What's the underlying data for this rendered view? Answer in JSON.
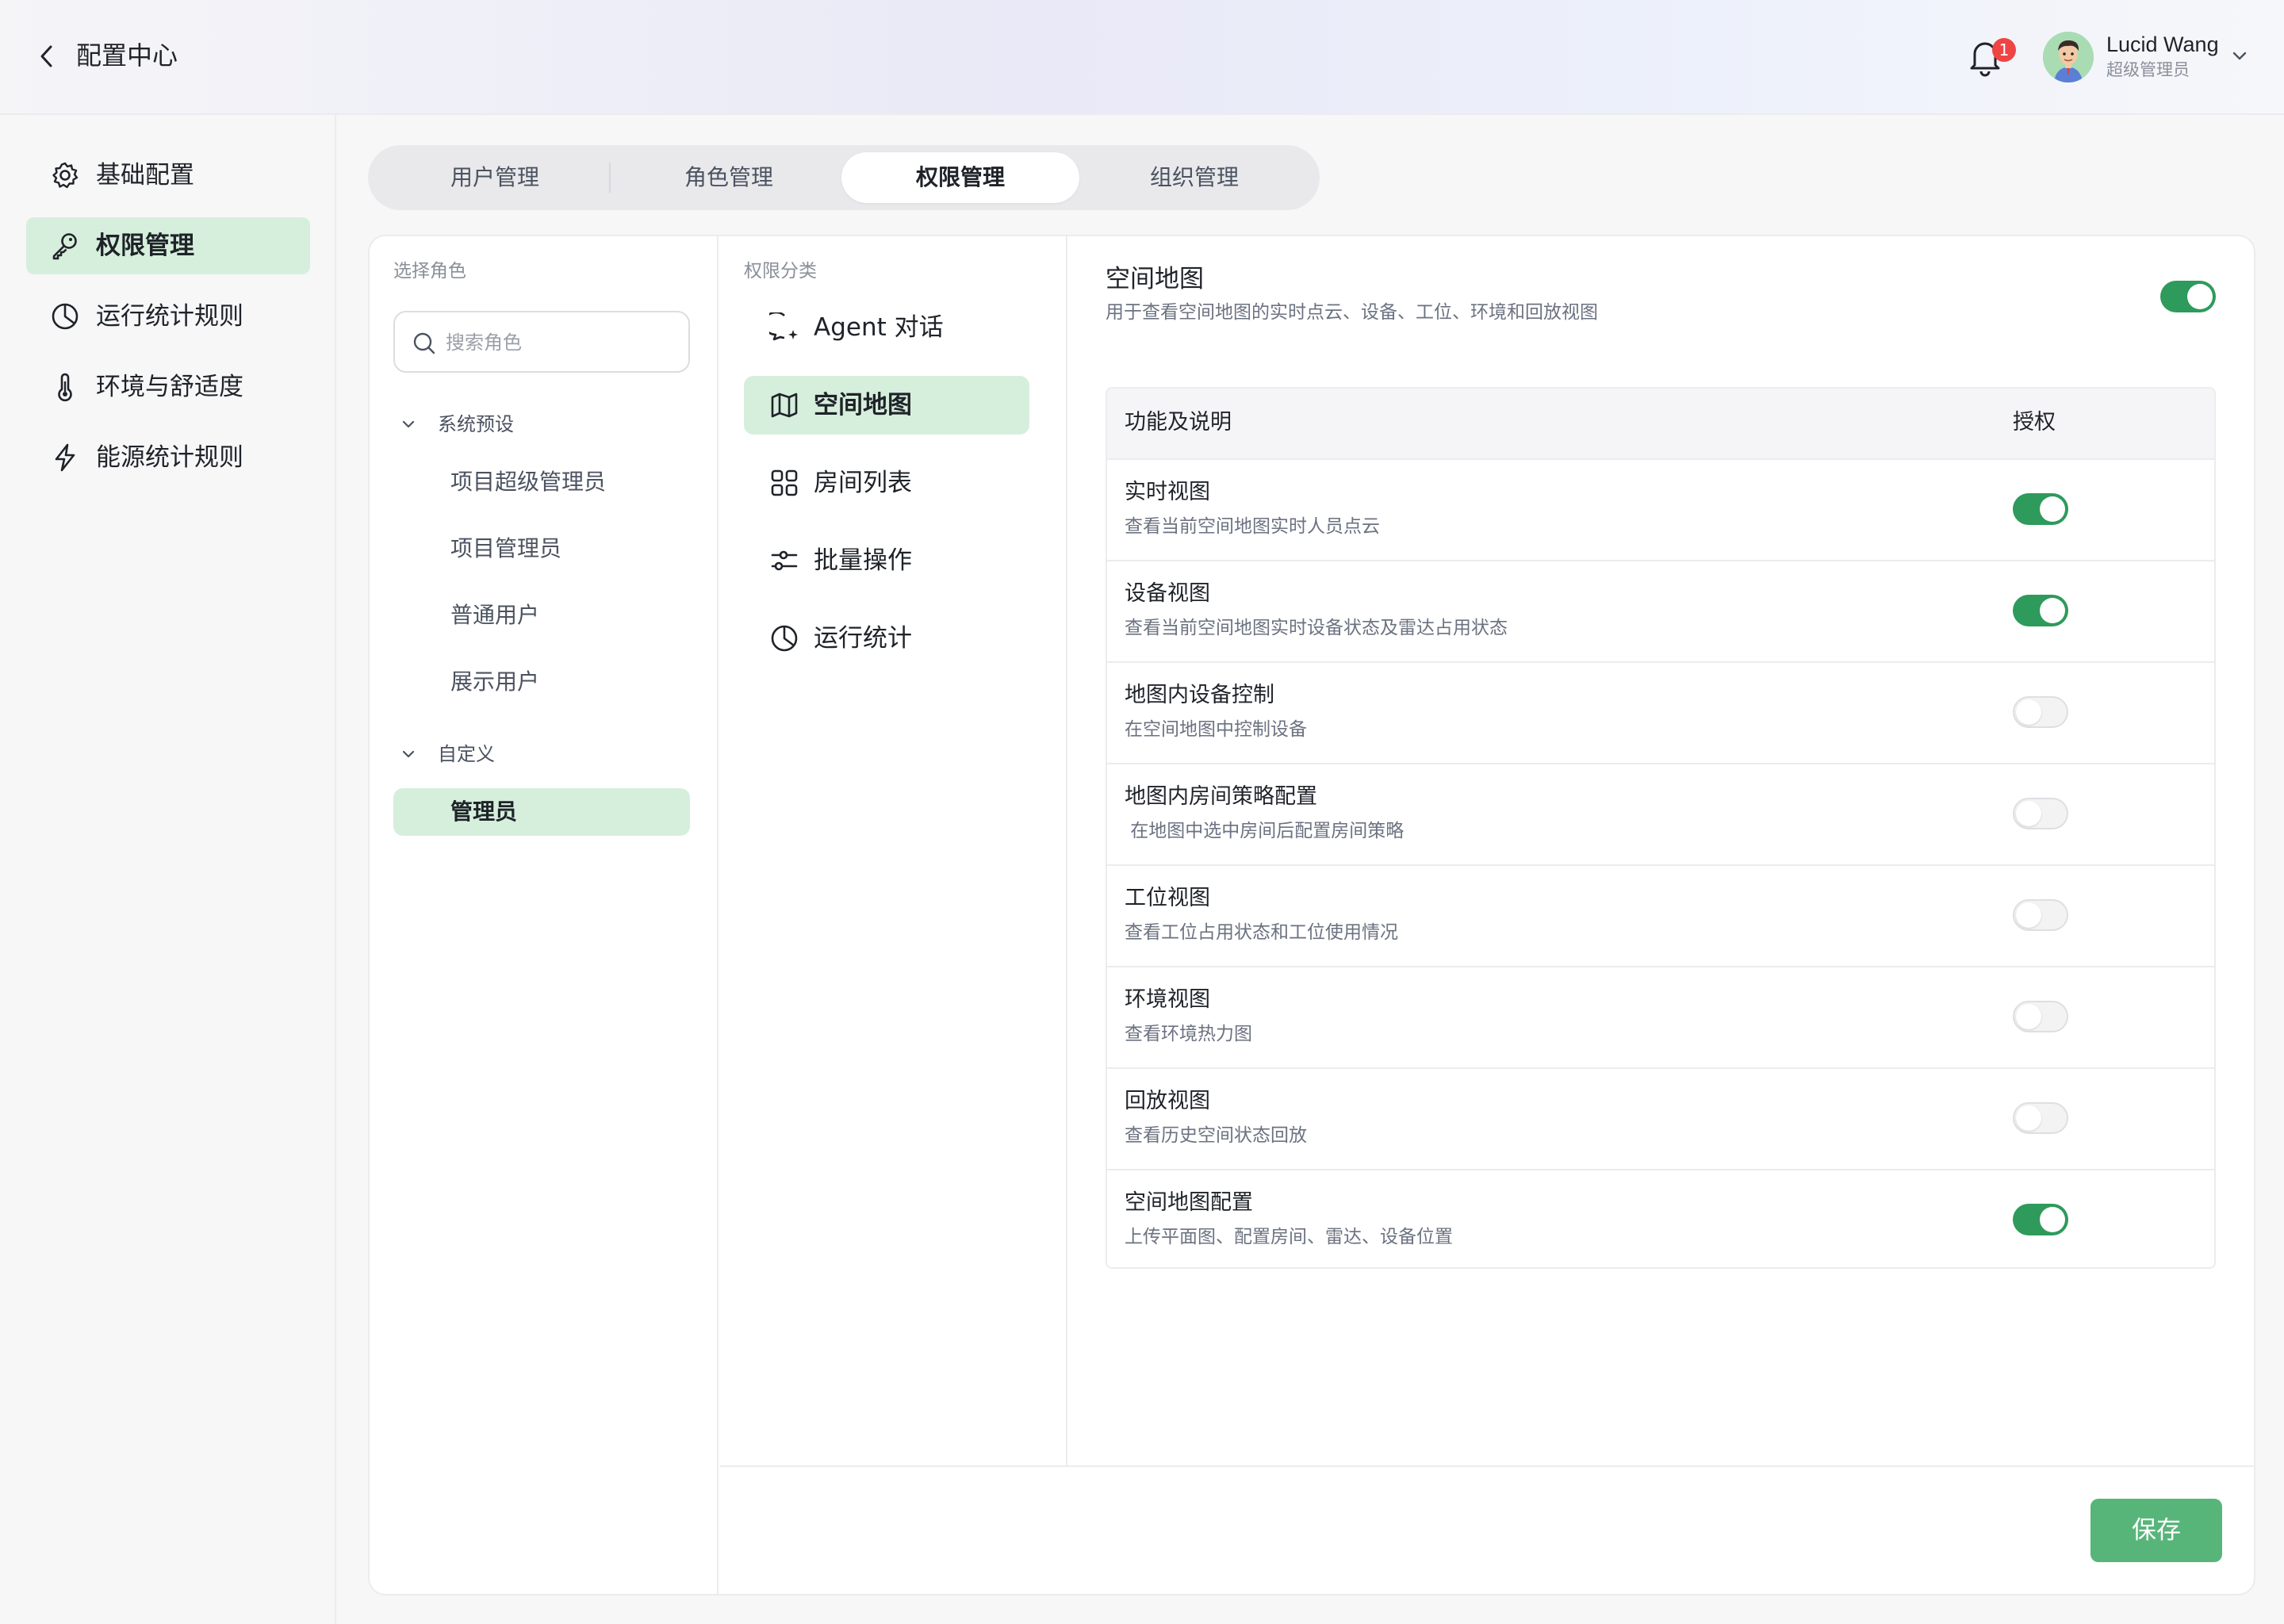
{
  "header": {
    "title": "配置中心",
    "notification_count": "1",
    "user": {
      "name": "Lucid Wang",
      "role": "超级管理员"
    }
  },
  "sidebar": {
    "items": [
      {
        "label": "基础配置",
        "icon": "gear-icon"
      },
      {
        "label": "权限管理",
        "icon": "key-icon",
        "active": true
      },
      {
        "label": "运行统计规则",
        "icon": "pie-chart-icon"
      },
      {
        "label": "环境与舒适度",
        "icon": "thermometer-icon"
      },
      {
        "label": "能源统计规则",
        "icon": "lightning-icon"
      }
    ]
  },
  "tabs": [
    {
      "label": "用户管理"
    },
    {
      "label": "角色管理"
    },
    {
      "label": "权限管理",
      "active": true
    },
    {
      "label": "组织管理"
    }
  ],
  "roles": {
    "section_label": "选择角色",
    "search_placeholder": "搜索角色",
    "groups": [
      {
        "label": "系统预设",
        "items": [
          "项目超级管理员",
          "项目管理员",
          "普通用户",
          "展示用户"
        ]
      },
      {
        "label": "自定义",
        "items": [
          "管理员"
        ]
      }
    ],
    "selected": "管理员"
  },
  "categories": {
    "section_label": "权限分类",
    "items": [
      {
        "label": "Agent 对话",
        "icon": "chat-sparkle-icon"
      },
      {
        "label": "空间地图",
        "icon": "map-icon",
        "active": true
      },
      {
        "label": "房间列表",
        "icon": "grid-icon"
      },
      {
        "label": "批量操作",
        "icon": "sliders-icon"
      },
      {
        "label": "运行统计",
        "icon": "pie-chart-icon"
      }
    ]
  },
  "detail": {
    "title": "空间地图",
    "description": "用于查看空间地图的实时点云、设备、工位、环境和回放视图",
    "enabled": true,
    "table": {
      "col_feature": "功能及说明",
      "col_auth": "授权",
      "rows": [
        {
          "name": "实时视图",
          "desc": "查看当前空间地图实时人员点云",
          "enabled": true
        },
        {
          "name": "设备视图",
          "desc": "查看当前空间地图实时设备状态及雷达占用状态",
          "enabled": true
        },
        {
          "name": "地图内设备控制",
          "desc": "在空间地图中控制设备",
          "enabled": false
        },
        {
          "name": "地图内房间策略配置",
          "desc": " 在地图中选中房间后配置房间策略",
          "enabled": false
        },
        {
          "name": "工位视图",
          "desc": "查看工位占用状态和工位使用情况",
          "enabled": false
        },
        {
          "name": "环境视图",
          "desc": "查看环境热力图",
          "enabled": false
        },
        {
          "name": "回放视图",
          "desc": "查看历史空间状态回放",
          "enabled": false
        },
        {
          "name": "空间地图配置",
          "desc": "上传平面图、配置房间、雷达、设备位置",
          "enabled": true
        }
      ]
    }
  },
  "actions": {
    "save_label": "保存"
  },
  "colors": {
    "accent": "#2e9a5c",
    "accent_light": "#d6efdc",
    "save_button": "#58b57a",
    "badge": "#ef4444"
  }
}
